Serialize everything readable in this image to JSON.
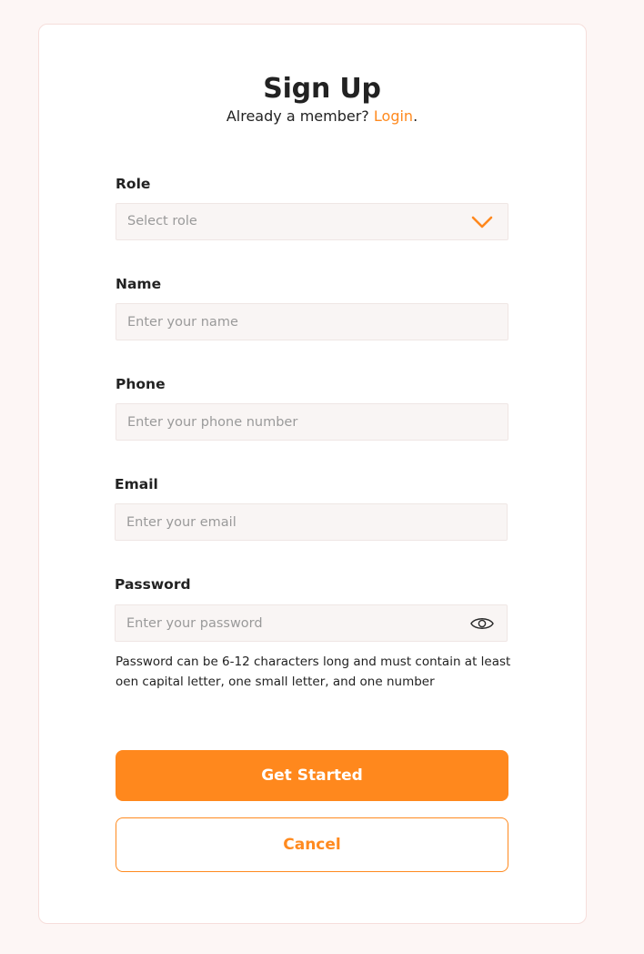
{
  "header": {
    "title": "Sign Up",
    "prompt": "Already a member? ",
    "login_link": "Login",
    "punct": "."
  },
  "form": {
    "role": {
      "label": "Role",
      "placeholder": "Select role",
      "icon": "chevron-down-icon"
    },
    "name": {
      "label": "Name",
      "placeholder": "Enter your name"
    },
    "phone": {
      "label": "Phone",
      "placeholder": "Enter your phone number"
    },
    "email": {
      "label": "Email",
      "placeholder": "Enter your email"
    },
    "password": {
      "label": "Password",
      "placeholder": "Enter your password",
      "icon": "eye-icon",
      "hint": "Password can be 6-12 characters long and must contain at least oen capital letter, one small letter, and one number"
    }
  },
  "actions": {
    "submit_label": "Get Started",
    "cancel_label": "Cancel"
  },
  "colors": {
    "accent": "#ff881d",
    "background": "#fdf6f5",
    "field_bg": "#f9f5f4"
  }
}
